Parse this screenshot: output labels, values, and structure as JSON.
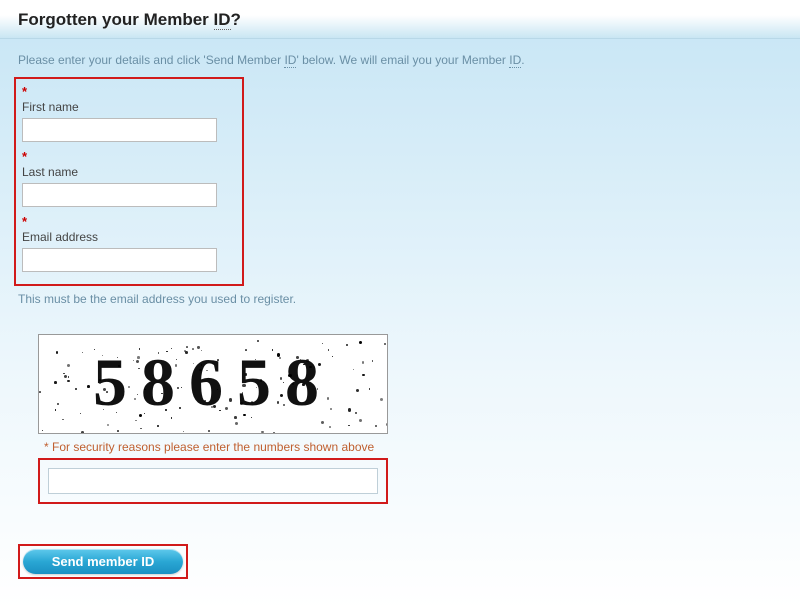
{
  "header": {
    "title_prefix": "Forgotten your Member ",
    "title_id": "ID",
    "title_suffix": "?"
  },
  "intro": {
    "text_before": "Please enter your details and click 'Send Member ",
    "id": "ID",
    "text_after": "' below. We will email you your Member ",
    "id2": "ID",
    "period": "."
  },
  "fields": {
    "required_marker": "*",
    "first_name": {
      "label": "First name",
      "value": ""
    },
    "last_name": {
      "label": "Last name",
      "value": ""
    },
    "email": {
      "label": "Email address",
      "value": ""
    },
    "email_hint": "This must be the email address you used to register."
  },
  "captcha": {
    "digits": "58658",
    "hint": "* For security reasons please enter the numbers shown above",
    "value": ""
  },
  "submit": {
    "label": "Send member ID"
  }
}
